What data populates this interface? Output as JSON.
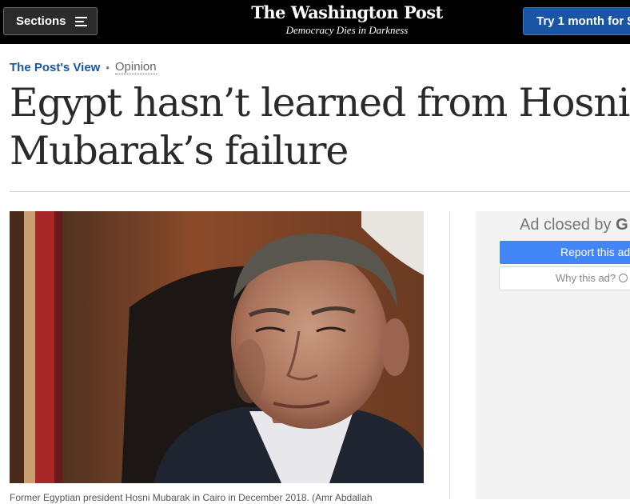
{
  "header": {
    "sections_label": "Sections",
    "logo_text": "The Washington Post",
    "tagline": "Democracy Dies in Darkness",
    "subscribe_label": "Try 1 month for $"
  },
  "article": {
    "kicker_primary": "The Post's View",
    "kicker_separator": "•",
    "kicker_secondary": "Opinion",
    "headline": "Egypt hasn’t learned from Hosni Mubarak’s failure",
    "caption": "Former Egyptian president Hosni Mubarak in Cairo in December 2018. (Amr Abdallah"
  },
  "ad": {
    "closed_text": "Ad closed by",
    "closed_brand": "G",
    "report_label": "Report this ad",
    "why_label": "Why this ad?"
  },
  "colors": {
    "topbar": "#000000",
    "subscribe_button": "#1955a5",
    "kicker_link": "#1955a5",
    "report_button": "#4285f4",
    "ad_background": "#f3f3f3"
  },
  "icons": {
    "menu": "hamburger-icon",
    "info": "info-icon"
  }
}
